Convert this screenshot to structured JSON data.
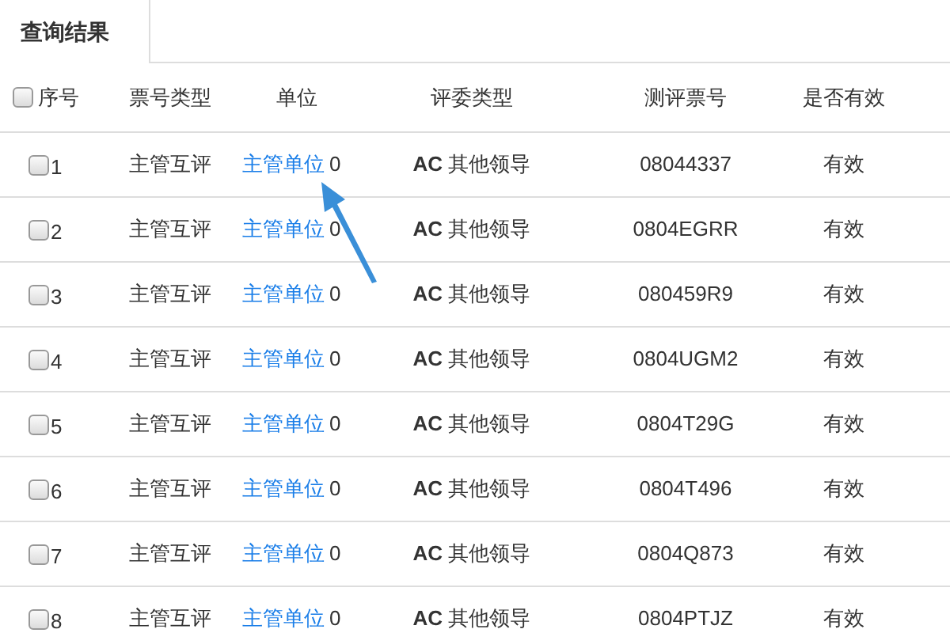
{
  "tabs": [
    {
      "label": "查询结果",
      "selected": true
    }
  ],
  "table": {
    "select_all": {
      "checked": false
    },
    "columns": [
      "序号",
      "票号类型",
      "单位",
      "评委类型",
      "测评票号",
      "是否有效"
    ],
    "rows": [
      {
        "checked": false,
        "index": "1",
        "ticket_type": "主管互评",
        "unit_link": "主管单位",
        "unit_count": "0",
        "judge_type": "**AC** 其他领导",
        "ticket_no": "08044337",
        "valid": "有效"
      },
      {
        "checked": false,
        "index": "2",
        "ticket_type": "主管互评",
        "unit_link": "主管单位",
        "unit_count": "0",
        "judge_type": "**AC** 其他领导",
        "ticket_no": "0804EGRR",
        "valid": "有效"
      },
      {
        "checked": false,
        "index": "3",
        "ticket_type": "主管互评",
        "unit_link": "主管单位",
        "unit_count": "0",
        "judge_type": "**AC** 其他领导",
        "ticket_no": "080459R9",
        "valid": "有效"
      },
      {
        "checked": false,
        "index": "4",
        "ticket_type": "主管互评",
        "unit_link": "主管单位",
        "unit_count": "0",
        "judge_type": "**AC** 其他领导",
        "ticket_no": "0804UGM2",
        "valid": "有效"
      },
      {
        "checked": false,
        "index": "5",
        "ticket_type": "主管互评",
        "unit_link": "主管单位",
        "unit_count": "0",
        "judge_type": "**AC** 其他领导",
        "ticket_no": "0804T29G",
        "valid": "有效"
      },
      {
        "checked": false,
        "index": "6",
        "ticket_type": "主管互评",
        "unit_link": "主管单位",
        "unit_count": "0",
        "judge_type": "**AC** 其他领导",
        "ticket_no": "0804T496",
        "valid": "有效"
      },
      {
        "checked": false,
        "index": "7",
        "ticket_type": "主管互评",
        "unit_link": "主管单位",
        "unit_count": "0",
        "judge_type": "**AC** 其他领导",
        "ticket_no": "0804Q873",
        "valid": "有效"
      },
      {
        "checked": false,
        "index": "8",
        "ticket_type": "主管互评",
        "unit_link": "主管单位",
        "unit_count": "0",
        "judge_type": "**AC** 其他领导",
        "ticket_no": "0804PTJZ",
        "valid": "有效"
      }
    ]
  }
}
